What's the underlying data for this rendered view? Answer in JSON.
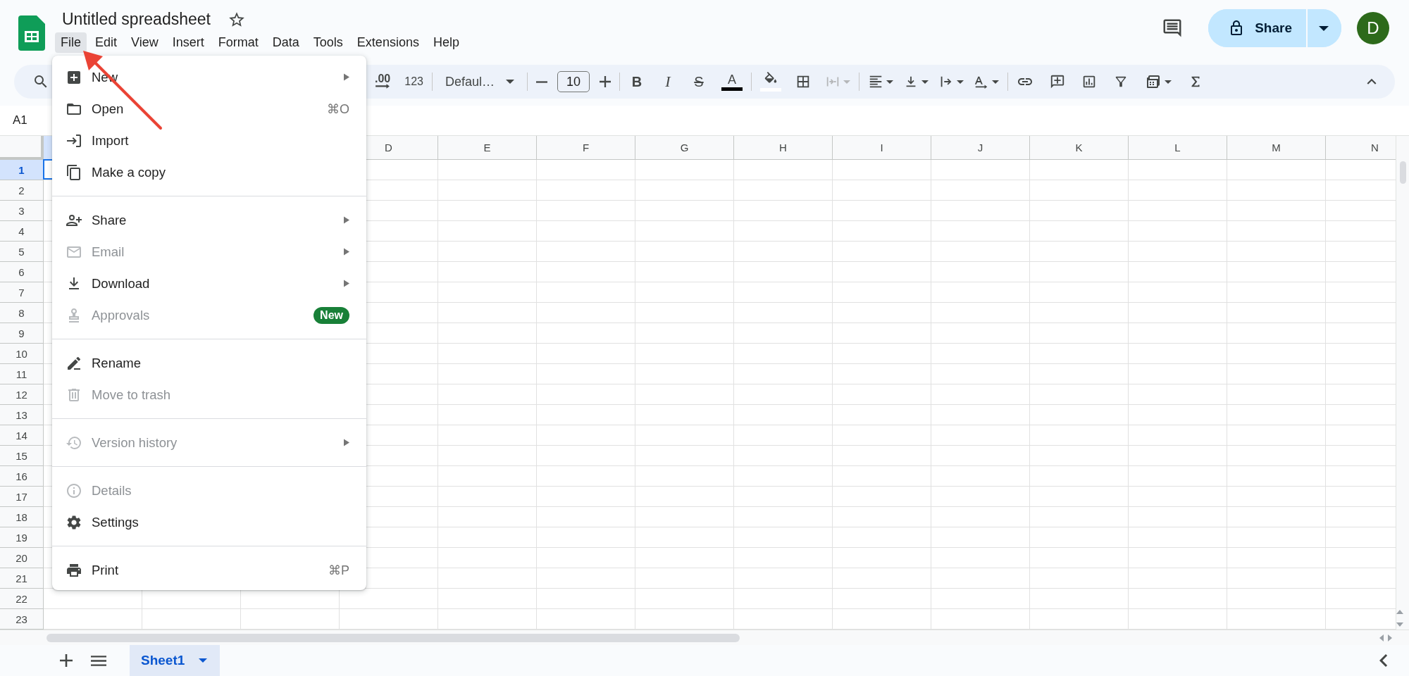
{
  "title": "Untitled spreadsheet",
  "menu_bar": [
    {
      "label": "File",
      "selected": true
    },
    {
      "label": "Edit",
      "selected": false
    },
    {
      "label": "View",
      "selected": false
    },
    {
      "label": "Insert",
      "selected": false
    },
    {
      "label": "Format",
      "selected": false
    },
    {
      "label": "Data",
      "selected": false
    },
    {
      "label": "Tools",
      "selected": false
    },
    {
      "label": "Extensions",
      "selected": false
    },
    {
      "label": "Help",
      "selected": false
    }
  ],
  "share_button": {
    "label": "Share"
  },
  "avatar": {
    "initial": "D"
  },
  "toolbar": {
    "decimal": ".00",
    "number_format": "123",
    "font": "Defaul…",
    "font_size": "10",
    "bold": "B",
    "italic": "I",
    "strikethrough": "S",
    "text_color": "A"
  },
  "name_box": "A1",
  "columns": [
    "D",
    "E",
    "F",
    "G",
    "H",
    "I",
    "J",
    "K",
    "L",
    "M",
    "N"
  ],
  "rows": [
    {
      "label": "1",
      "selected": true
    },
    {
      "label": "2",
      "selected": false
    },
    {
      "label": "3",
      "selected": false
    },
    {
      "label": "4",
      "selected": false
    },
    {
      "label": "5",
      "selected": false
    },
    {
      "label": "6",
      "selected": false
    },
    {
      "label": "7",
      "selected": false
    },
    {
      "label": "8",
      "selected": false
    },
    {
      "label": "9",
      "selected": false
    },
    {
      "label": "10",
      "selected": false
    },
    {
      "label": "11",
      "selected": false
    },
    {
      "label": "12",
      "selected": false
    },
    {
      "label": "13",
      "selected": false
    },
    {
      "label": "14",
      "selected": false
    },
    {
      "label": "15",
      "selected": false
    },
    {
      "label": "16",
      "selected": false
    },
    {
      "label": "17",
      "selected": false
    },
    {
      "label": "18",
      "selected": false
    },
    {
      "label": "19",
      "selected": false
    },
    {
      "label": "20",
      "selected": false
    },
    {
      "label": "21",
      "selected": false
    },
    {
      "label": "22",
      "selected": false
    },
    {
      "label": "23",
      "selected": false
    }
  ],
  "file_menu": [
    [
      {
        "label": "New",
        "submenu": true,
        "disabled": false
      },
      {
        "label": "Open",
        "submenu": false,
        "disabled": false,
        "shortcut": "⌘O"
      },
      {
        "label": "Import",
        "submenu": false,
        "disabled": false
      },
      {
        "label": "Make a copy",
        "submenu": false,
        "disabled": false
      }
    ],
    [
      {
        "label": "Share",
        "submenu": true,
        "disabled": false
      },
      {
        "label": "Email",
        "submenu": true,
        "disabled": true
      },
      {
        "label": "Download",
        "submenu": true,
        "disabled": false
      },
      {
        "label": "Approvals",
        "submenu": false,
        "disabled": true,
        "badge": "New"
      }
    ],
    [
      {
        "label": "Rename",
        "submenu": false,
        "disabled": false
      },
      {
        "label": "Move to trash",
        "submenu": false,
        "disabled": true
      }
    ],
    [
      {
        "label": "Version history",
        "submenu": true,
        "disabled": true
      }
    ],
    [
      {
        "label": "Details",
        "submenu": false,
        "disabled": true
      },
      {
        "label": "Settings",
        "submenu": false,
        "disabled": false
      }
    ],
    [
      {
        "label": "Print",
        "submenu": false,
        "disabled": false,
        "shortcut": "⌘P"
      }
    ]
  ],
  "sheet_tabs": [
    {
      "label": "Sheet1",
      "selected": true
    }
  ]
}
